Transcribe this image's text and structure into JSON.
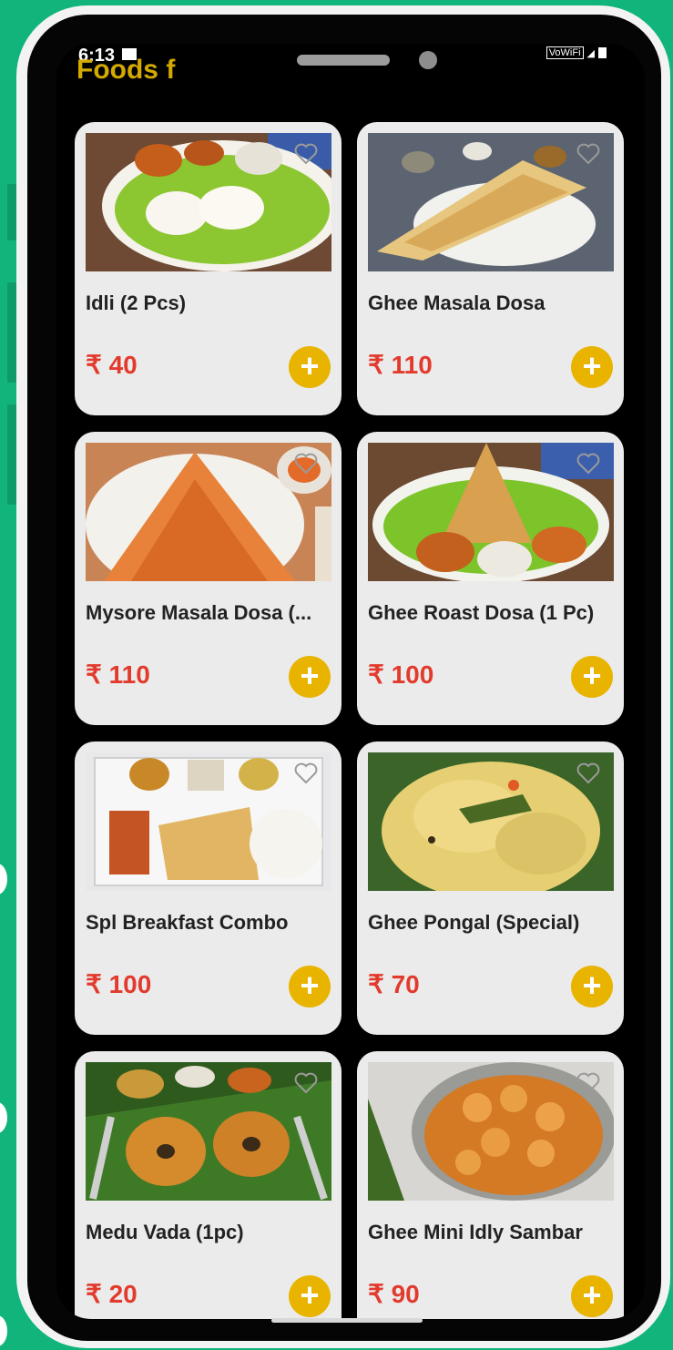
{
  "status": {
    "time": "6:13",
    "signal": "VoWiFi"
  },
  "header": {
    "title": "Foods f"
  },
  "items": [
    {
      "name": "Idli (2 Pcs)",
      "price": "₹ 40"
    },
    {
      "name": "Ghee Masala Dosa",
      "price": "₹ 110"
    },
    {
      "name": "Mysore Masala Dosa (...",
      "price": "₹ 110"
    },
    {
      "name": "Ghee Roast Dosa (1 Pc)",
      "price": "₹ 100"
    },
    {
      "name": "Spl Breakfast Combo",
      "price": "₹ 100"
    },
    {
      "name": "Ghee Pongal (Special)",
      "price": "₹ 70"
    },
    {
      "name": "Medu Vada (1pc)",
      "price": "₹ 20"
    },
    {
      "name": "Ghee Mini Idly Sambar",
      "price": "₹ 90"
    }
  ],
  "icons": {
    "favorite": "heart-icon",
    "add": "plus-icon"
  },
  "colors": {
    "background": "#11b57c",
    "accent": "#e8b400",
    "price": "#e23b2d",
    "title": "#d4a900"
  }
}
